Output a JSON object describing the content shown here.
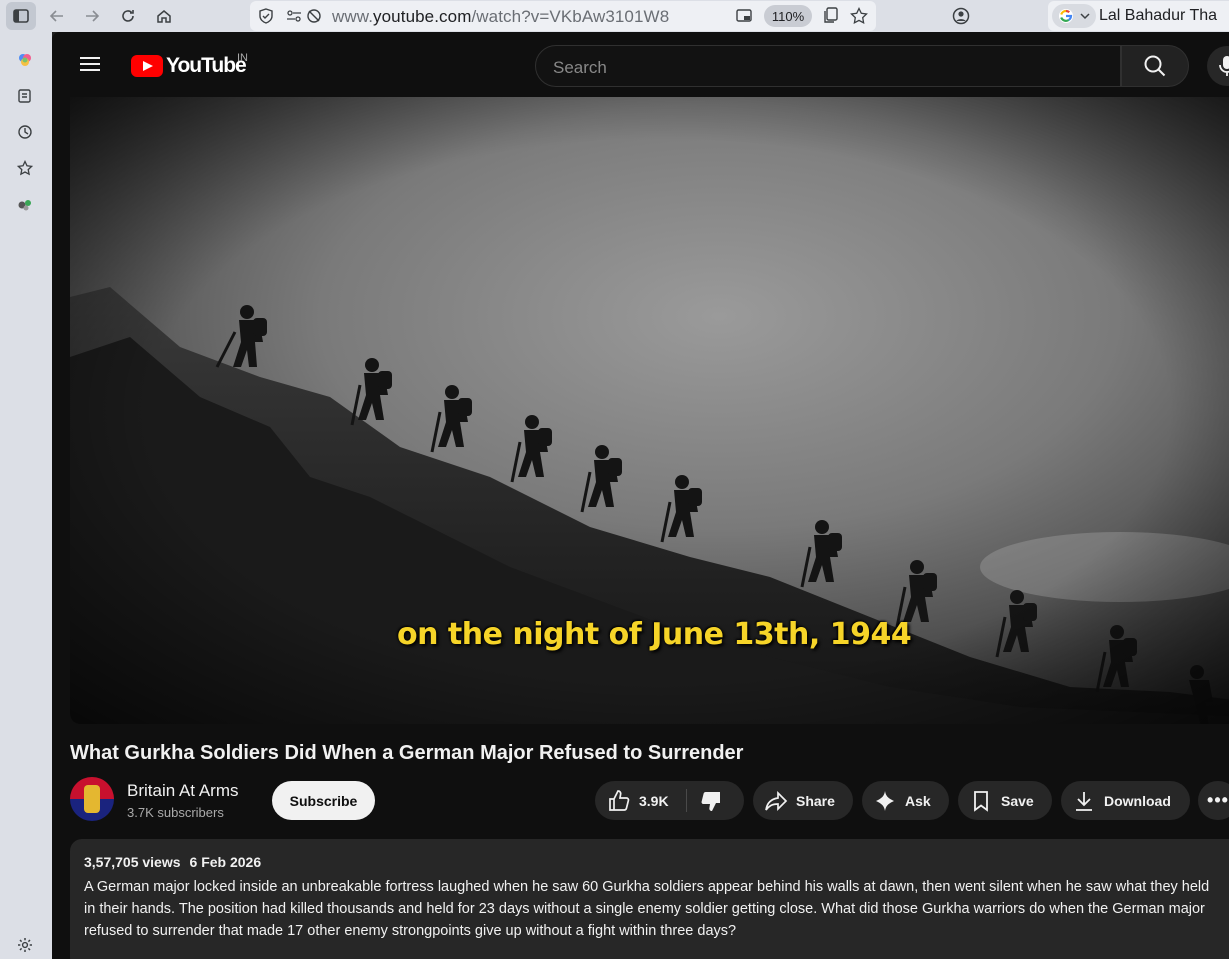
{
  "browser": {
    "url_prefix": "www.",
    "url_domain": "youtube.com",
    "url_path": "/watch?v=VKbAw3101W8",
    "zoom": "110%",
    "profile_text": "Lal Bahadur Tha"
  },
  "youtube": {
    "logo_text": "YouTube",
    "country_code": "IN",
    "search_placeholder": "Search"
  },
  "video": {
    "caption": "on the night of June 13th, 1944",
    "title": "What Gurkha Soldiers Did When a German Major Refused to Surrender"
  },
  "channel": {
    "name": "Britain At Arms",
    "subscribers": "3.7K subscribers",
    "subscribe_label": "Subscribe"
  },
  "actions": {
    "likes": "3.9K",
    "share": "Share",
    "ask": "Ask",
    "save": "Save",
    "download": "Download",
    "more": "•••"
  },
  "description": {
    "views": "3,57,705 views",
    "date": "6 Feb 2026",
    "text": "A German major locked inside an unbreakable fortress laughed when he saw 60 Gurkha soldiers appear behind his walls at dawn, then went silent when he saw what they held in their hands. The position had killed thousands and held for 23 days without a single enemy soldier getting close. What did those Gurkha warriors do when the German major refused to surrender that made 17 other enemy strongpoints give up without a fight within three days?"
  },
  "icons": [
    "sidebar-toggle-icon",
    "back-arrow-icon",
    "forward-arrow-icon",
    "reload-icon",
    "home-icon",
    "shield-icon",
    "permissions-icon",
    "tracking-off-icon",
    "pip-icon",
    "copy-icon",
    "bookmark-star-icon",
    "account-icon",
    "google-icon",
    "menu-icon",
    "search-icon",
    "mic-icon",
    "like-icon",
    "dislike-icon",
    "share-icon",
    "sparkle-icon",
    "save-icon",
    "download-icon",
    "settings-icon"
  ]
}
